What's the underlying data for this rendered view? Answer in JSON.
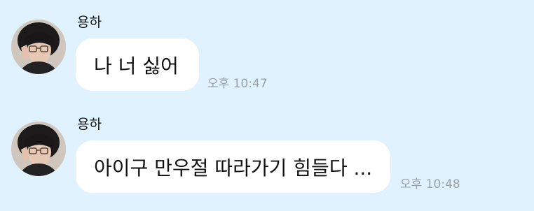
{
  "chat": {
    "messages": [
      {
        "sender": "용하",
        "text": "나 너 싫어",
        "time": "오후 10:47"
      },
      {
        "sender": "용하",
        "text": "아이구 만우절 따라가기 힘들다 ...",
        "time": "오후 10:48"
      }
    ]
  },
  "colors": {
    "background": "#dff2fd",
    "bubble": "#ffffff",
    "text": "#111111",
    "timestamp": "#9aa2a8"
  }
}
